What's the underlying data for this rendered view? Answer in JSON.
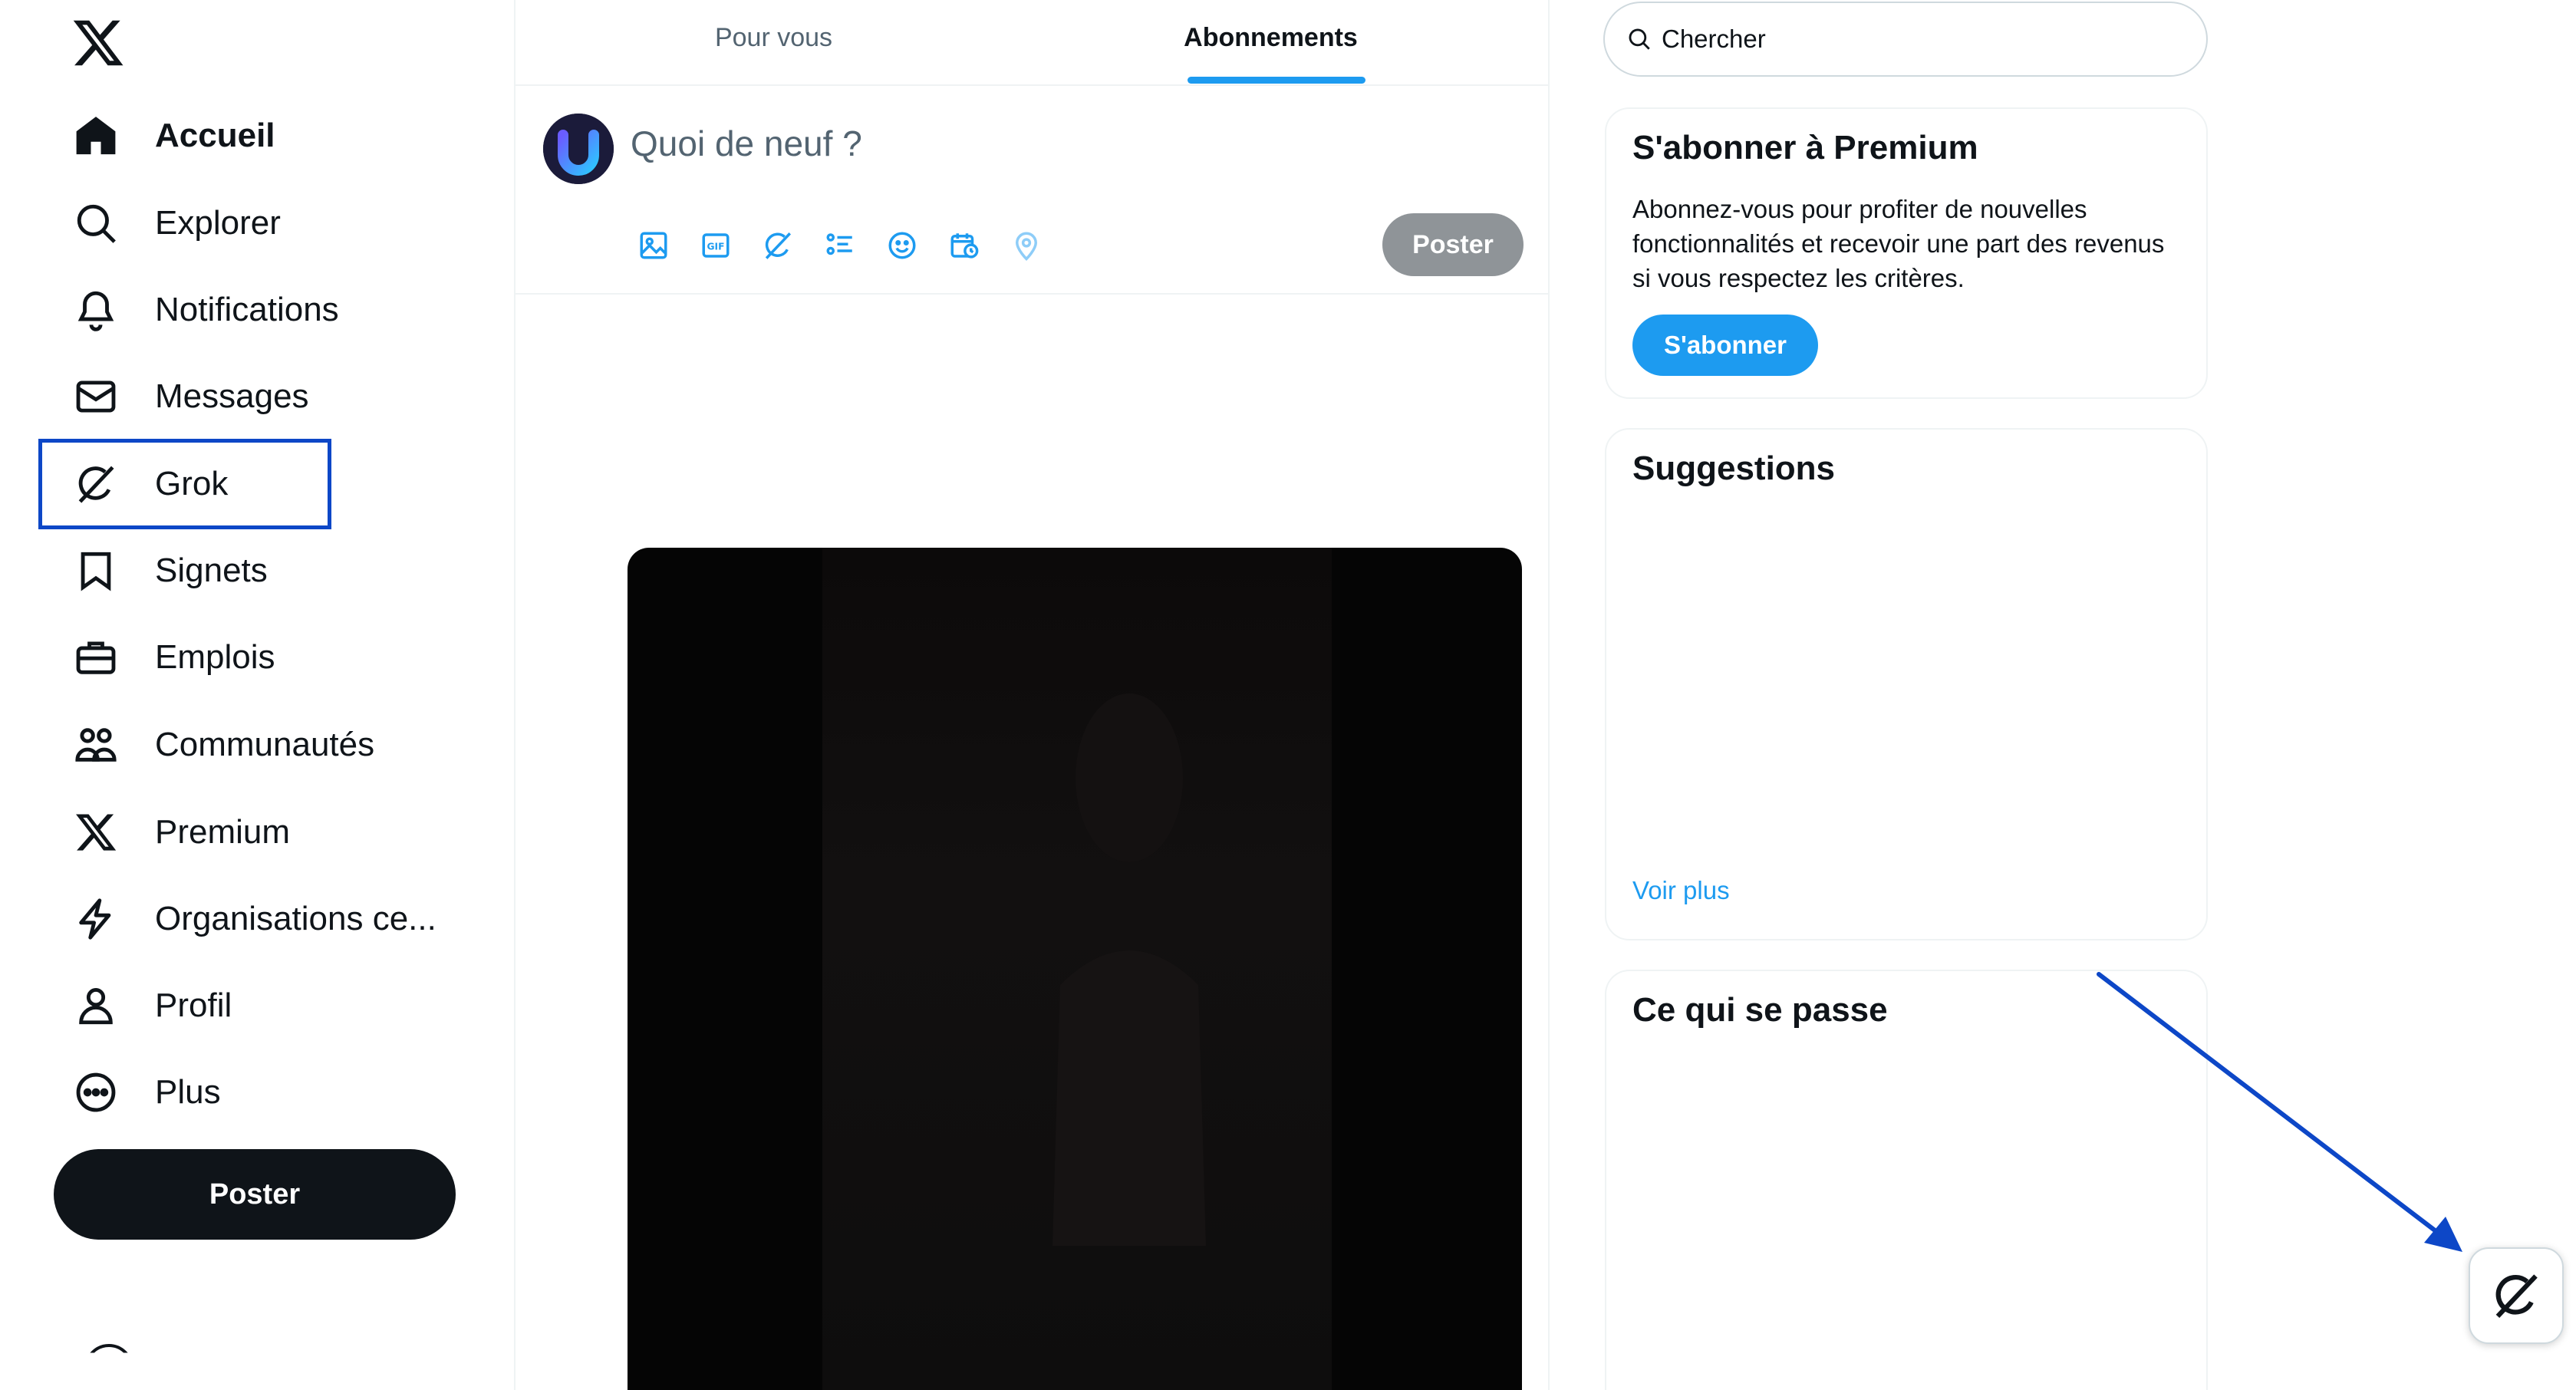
{
  "sidebar": {
    "items": [
      {
        "label": "Accueil",
        "icon": "home-icon",
        "active": true
      },
      {
        "label": "Explorer",
        "icon": "search-icon"
      },
      {
        "label": "Notifications",
        "icon": "bell-icon"
      },
      {
        "label": "Messages",
        "icon": "envelope-icon"
      },
      {
        "label": "Grok",
        "icon": "grok-icon"
      },
      {
        "label": "Signets",
        "icon": "bookmark-icon"
      },
      {
        "label": "Emplois",
        "icon": "briefcase-icon"
      },
      {
        "label": "Communautés",
        "icon": "people-icon"
      },
      {
        "label": "Premium",
        "icon": "x-logo-icon"
      },
      {
        "label": "Organisations ce...",
        "icon": "lightning-icon"
      },
      {
        "label": "Profil",
        "icon": "person-icon"
      },
      {
        "label": "Plus",
        "icon": "more-circle-icon"
      }
    ],
    "post_label": "Poster"
  },
  "tabs": {
    "for_you": "Pour vous",
    "following": "Abonnements",
    "active": "following"
  },
  "composer": {
    "placeholder": "Quoi de neuf ?",
    "post_label": "Poster",
    "tools": [
      "image-icon",
      "gif-icon",
      "grok-icon",
      "poll-icon",
      "emoji-icon",
      "schedule-icon",
      "location-icon"
    ]
  },
  "search": {
    "placeholder": "Chercher"
  },
  "premium": {
    "title": "S'abonner à Premium",
    "description": "Abonnez-vous pour profiter de nouvelles fonctionnalités et recevoir une part des revenus si vous respectez les critères.",
    "button": "S'abonner"
  },
  "suggestions": {
    "title": "Suggestions",
    "more": "Voir plus"
  },
  "happening": {
    "title": "Ce qui se passe"
  },
  "colors": {
    "accent": "#1d9bf0",
    "highlight": "#0d47c7",
    "text": "#0f1419",
    "muted": "#536471"
  }
}
